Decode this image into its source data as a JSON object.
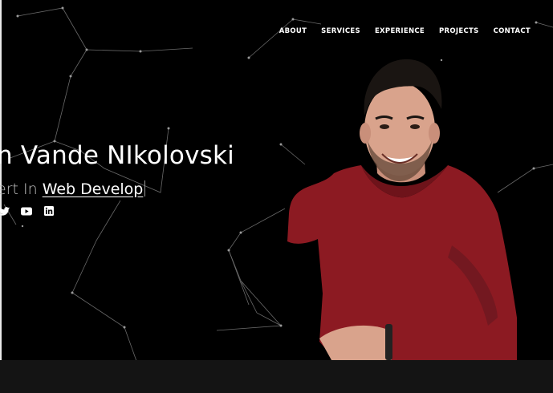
{
  "nav": {
    "links": [
      "ABOUT",
      "SERVICES",
      "EXPERIENCE",
      "PROJECTS",
      "CONTACT"
    ]
  },
  "hero": {
    "name": "n Vande NIkolovski",
    "subtitle_prefix": "ert In ",
    "subtitle_typed": "Web Develop"
  },
  "socials": [
    "twitter-icon",
    "youtube-icon",
    "linkedin-icon"
  ],
  "colors": {
    "background": "#000000",
    "text": "#ffffff",
    "sweater": "#8c1a22",
    "footer": "#141414"
  }
}
